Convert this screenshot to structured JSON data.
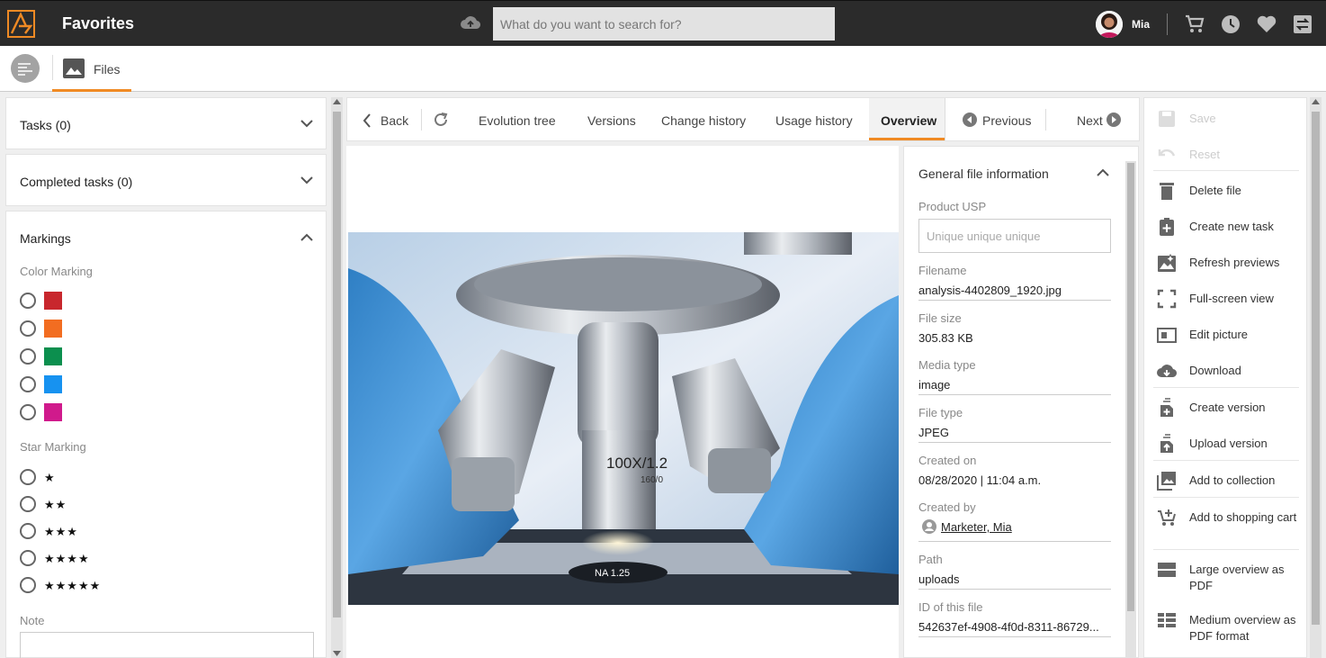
{
  "topbar": {
    "title": "Favorites",
    "search_placeholder": "What do you want to search for?",
    "user_name": "Mia"
  },
  "subbar": {
    "files_label": "Files"
  },
  "left": {
    "tasks": "Tasks (0)",
    "completed_tasks": "Completed tasks (0)",
    "markings": "Markings",
    "color_marking": "Color Marking",
    "colors": [
      "#c8272d",
      "#f26d21",
      "#0c8f4e",
      "#1792f0",
      "#d01a8c"
    ],
    "star_marking": "Star Marking",
    "stars": [
      "★",
      "★★",
      "★★★",
      "★★★★",
      "★★★★★"
    ],
    "note": "Note"
  },
  "tabs": {
    "back": "Back",
    "evolution_tree": "Evolution tree",
    "versions": "Versions",
    "change_history": "Change history",
    "usage_history": "Usage history",
    "overview": "Overview",
    "previous": "Previous",
    "next": "Next"
  },
  "info": {
    "title": "General file information",
    "usp_label": "Product USP",
    "usp_placeholder": "Unique unique unique",
    "filename_label": "Filename",
    "filename": "analysis-4402809_1920.jpg",
    "filesize_label": "File size",
    "filesize": "305.83 KB",
    "mediatype_label": "Media type",
    "mediatype": "image",
    "filetype_label": "File type",
    "filetype": "JPEG",
    "created_on_label": "Created on",
    "created_on": "08/28/2020 | 11:04 a.m.",
    "created_by_label": "Created by",
    "created_by": "Marketer, Mia",
    "path_label": "Path",
    "path": "uploads",
    "id_label": "ID of this file",
    "id": "542637ef-4908-4f0d-8311-86729..."
  },
  "image": {
    "lens_text": "100X/1.2",
    "lens_sub": "160/0",
    "stage_text": "NA 1.25"
  },
  "actions": {
    "save": "Save",
    "reset": "Reset",
    "delete_file": "Delete file",
    "create_task": "Create new task",
    "refresh_previews": "Refresh previews",
    "full_screen": "Full-screen view",
    "edit_picture": "Edit picture",
    "download": "Download",
    "create_version": "Create version",
    "upload_version": "Upload version",
    "add_collection": "Add to collection",
    "add_cart": "Add to shopping cart",
    "large_pdf": "Large overview as PDF",
    "medium_pdf": "Medium overview as PDF format"
  },
  "colors": {
    "accent": "#f08a24",
    "topbar": "#2b2b2b"
  }
}
